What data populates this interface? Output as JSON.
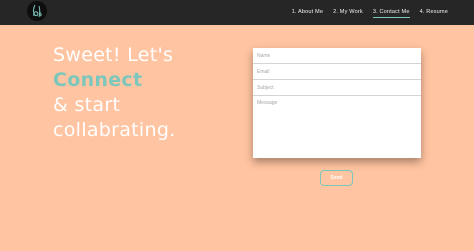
{
  "nav": {
    "links": [
      {
        "label": "1. About Me"
      },
      {
        "label": "2. My Work"
      },
      {
        "label": "3. Contact Me",
        "active": true
      },
      {
        "label": "4. Resume"
      }
    ]
  },
  "hero": {
    "line1": "Sweet! Let's",
    "line2": "Connect",
    "line3": "& start",
    "line4": "collabrating."
  },
  "form": {
    "name_placeholder": "Name",
    "email_placeholder": "Email",
    "subject_placeholder": "Subject",
    "message_placeholder": "Message",
    "send_label": "Send"
  },
  "colors": {
    "navbar": "#262626",
    "background": "#ffc4a1",
    "accent": "#7cc7bc"
  }
}
